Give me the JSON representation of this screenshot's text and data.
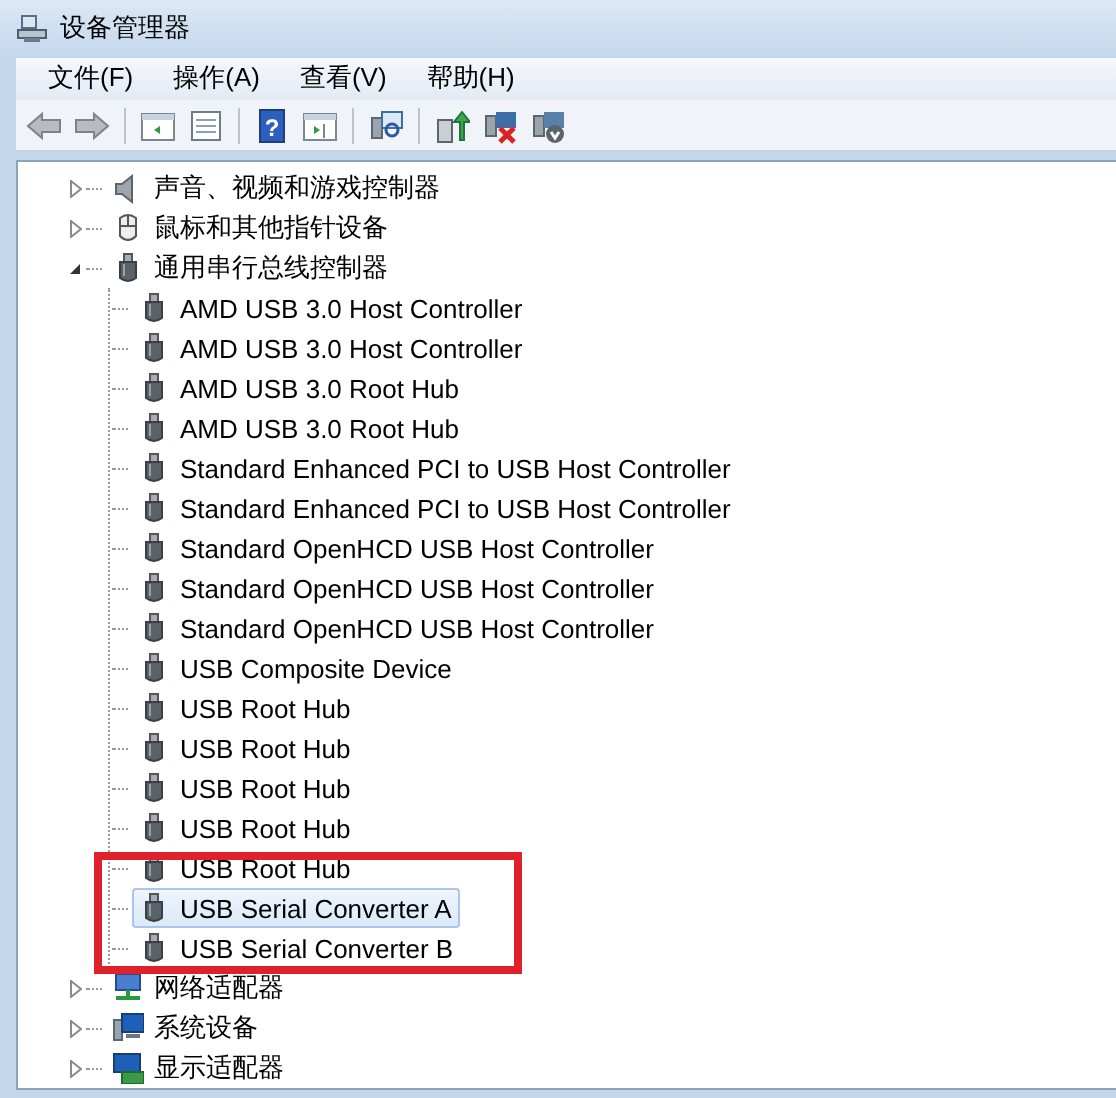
{
  "window": {
    "title": "设备管理器"
  },
  "menu": [
    {
      "label": "文件(F)"
    },
    {
      "label": "操作(A)"
    },
    {
      "label": "查看(V)"
    },
    {
      "label": "帮助(H)"
    }
  ],
  "toolbar": [
    {
      "kind": "back"
    },
    {
      "kind": "forward"
    },
    {
      "kind": "sep"
    },
    {
      "kind": "tree"
    },
    {
      "kind": "props"
    },
    {
      "kind": "sep"
    },
    {
      "kind": "help",
      "glyph": "?"
    },
    {
      "kind": "pane"
    },
    {
      "kind": "sep"
    },
    {
      "kind": "scan"
    },
    {
      "kind": "sep"
    },
    {
      "kind": "update"
    },
    {
      "kind": "disable"
    },
    {
      "kind": "uninstall"
    }
  ],
  "tree": [
    {
      "label": "声音、视频和游戏控制器",
      "kind": "sound",
      "expanded": false,
      "selected": false
    },
    {
      "label": "鼠标和其他指针设备",
      "kind": "mouse",
      "expanded": false,
      "selected": false
    },
    {
      "label": "通用串行总线控制器",
      "kind": "usb",
      "expanded": true,
      "selected": false,
      "children": [
        {
          "label": "AMD USB 3.0 Host Controller",
          "kind": "usb",
          "selected": false
        },
        {
          "label": "AMD USB 3.0 Host Controller",
          "kind": "usb",
          "selected": false
        },
        {
          "label": "AMD USB 3.0 Root Hub",
          "kind": "usb",
          "selected": false
        },
        {
          "label": "AMD USB 3.0 Root Hub",
          "kind": "usb",
          "selected": false
        },
        {
          "label": "Standard Enhanced PCI to USB Host Controller",
          "kind": "usb",
          "selected": false
        },
        {
          "label": "Standard Enhanced PCI to USB Host Controller",
          "kind": "usb",
          "selected": false
        },
        {
          "label": "Standard OpenHCD USB Host Controller",
          "kind": "usb",
          "selected": false
        },
        {
          "label": "Standard OpenHCD USB Host Controller",
          "kind": "usb",
          "selected": false
        },
        {
          "label": "Standard OpenHCD USB Host Controller",
          "kind": "usb",
          "selected": false
        },
        {
          "label": "USB Composite Device",
          "kind": "usb",
          "selected": false
        },
        {
          "label": "USB Root Hub",
          "kind": "usb",
          "selected": false
        },
        {
          "label": "USB Root Hub",
          "kind": "usb",
          "selected": false
        },
        {
          "label": "USB Root Hub",
          "kind": "usb",
          "selected": false
        },
        {
          "label": "USB Root Hub",
          "kind": "usb",
          "selected": false
        },
        {
          "label": "USB Root Hub",
          "kind": "usb",
          "selected": false
        },
        {
          "label": "USB Serial Converter A",
          "kind": "usb",
          "selected": true
        },
        {
          "label": "USB Serial Converter B",
          "kind": "usb",
          "selected": false
        }
      ]
    },
    {
      "label": "网络适配器",
      "kind": "network",
      "expanded": false,
      "selected": false
    },
    {
      "label": "系统设备",
      "kind": "computer",
      "expanded": false,
      "selected": false
    },
    {
      "label": "显示适配器",
      "kind": "display",
      "expanded": false,
      "selected": false
    }
  ],
  "highlight": {
    "kind": "red-frame"
  }
}
